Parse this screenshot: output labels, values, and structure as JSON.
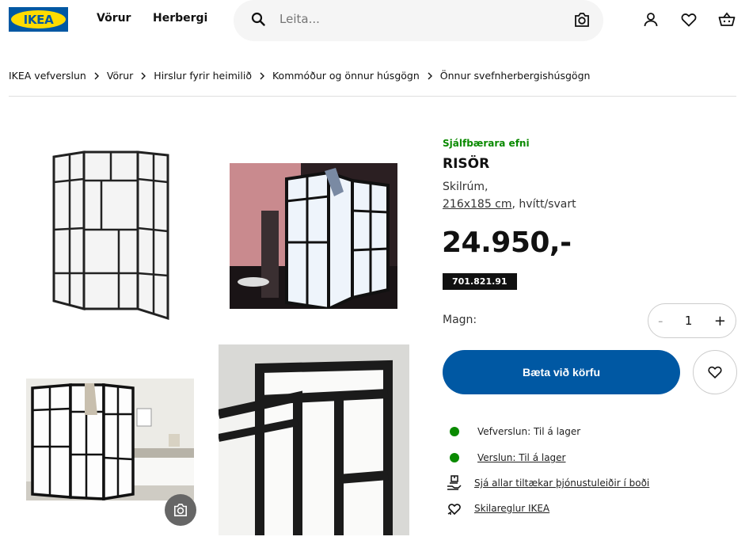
{
  "header": {
    "logo_text": "IKEA",
    "nav": [
      "Vörur",
      "Herbergi"
    ],
    "search_placeholder": "Leita..."
  },
  "breadcrumb": [
    "IKEA vefverslun",
    "Vörur",
    "Hirslur fyrir heimilið",
    "Kommóður og önnur húsgögn",
    "Önnur svefnherbergishúsgögn"
  ],
  "product": {
    "badge": "Sjálfbærara efni",
    "name": "RISÖR",
    "type": "Skilrúm,",
    "size": "216x185 cm",
    "color": ", hvítt/svart",
    "price": "24.950,-",
    "article_number": "701.821.91",
    "quantity_label": "Magn:",
    "quantity": "1",
    "add_to_cart": "Bæta við körfu"
  },
  "availability": {
    "online": "Vefverslun: Til á lager",
    "store": "Verslun: Til á lager",
    "services": "Sjá allar tiltækar þjónustuleiðir í boði",
    "returns": "Skilareglur IKEA"
  },
  "colors": {
    "brand_blue": "#0058a3",
    "brand_yellow": "#ffdb00",
    "stock_green": "#0a8a00"
  },
  "icons": [
    "search-icon",
    "camera-icon",
    "user-icon",
    "heart-icon",
    "cart-icon",
    "chevron-right-icon",
    "delivery-icon",
    "returns-icon"
  ]
}
